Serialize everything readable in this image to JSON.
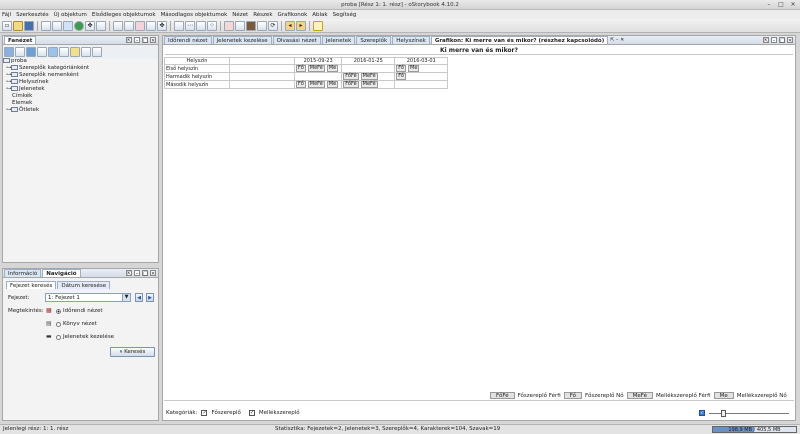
{
  "window": {
    "title": "proba [Rész 1: 1. rész] - oStorybook 4.10.2",
    "controls": [
      "–",
      "□",
      "✕"
    ]
  },
  "menu": [
    "Fájl",
    "Szerkesztés",
    "Új objektum",
    "Elsődleges objektumok",
    "Másodlagos objektumok",
    "Nézet",
    "Részek",
    "Grafikonok",
    "Ablak",
    "Segítség"
  ],
  "left_top_panel": {
    "tab": "Fanézet",
    "tree": {
      "root": "proba",
      "items": [
        "Szereplők kategóriánként",
        "Szereplők nemenként",
        "Helyszínek",
        "Jelenetek",
        "Címkék",
        "Elemek",
        "Ötletek"
      ]
    }
  },
  "left_bottom_panel": {
    "tabs": [
      "Információ",
      "Navigáció"
    ],
    "subtabs": [
      "Fejezet keresés",
      "Dátum keresése"
    ],
    "chapter_label": "Fejezet:",
    "chapter_value": "1: Fejezet 1",
    "view_label": "Megtekintés:",
    "views": [
      "Időrendi nézet",
      "Könyv nézet",
      "Jelenetek kezelése"
    ],
    "search_button": "Keresés"
  },
  "main_tabs": [
    "Időrendi nézet",
    "Jelenetek kezelése",
    "Olvasási nézet",
    "Jelenetek",
    "Szereplők",
    "Helyszínek",
    "Grafikon: Ki merre van és mikor? (részhez kapcsolódó)"
  ],
  "chart_data": {
    "type": "table",
    "title": "Ki merre van és mikor?",
    "header": "Helyszín",
    "columns": [
      "2015-09-23",
      "2016-01-25",
      "2016-03-01"
    ],
    "rows": [
      {
        "name": "Első helyszín",
        "cells": [
          [
            "Fő",
            "MeFé",
            "Me"
          ],
          [],
          [
            "Fő",
            "Me"
          ]
        ]
      },
      {
        "name": "Harmadik helyszín",
        "cells": [
          [],
          [
            "FőFé",
            "MeFé"
          ],
          [
            "Fő"
          ]
        ]
      },
      {
        "name": "Második helyszín",
        "cells": [
          [
            "Fő",
            "MeFé",
            "Me"
          ],
          [
            "FőFé",
            "MeFé"
          ],
          []
        ]
      }
    ]
  },
  "legend": [
    {
      "code": "FőFé",
      "label": "Főszereplő Férfi"
    },
    {
      "code": "Fő",
      "label": "Főszereplő Nő"
    },
    {
      "code": "MeFé",
      "label": "Mellékszereplő Férfi"
    },
    {
      "code": "Me",
      "label": "Mellékszereplő Nő"
    }
  ],
  "categories": {
    "label": "Kategóriák:",
    "items": [
      "Főszereplő",
      "Mellékszereplő"
    ]
  },
  "status": {
    "left": "Jelenlegi rész: 1: 1. rész",
    "center": "Statisztika: Fejezetek=2, Jelenetek=3, Szereplők=4, Karakterek=104, Szavak=19",
    "memory": "198,9 MB / 405,5 MB",
    "memory_fraction": 0.49
  }
}
